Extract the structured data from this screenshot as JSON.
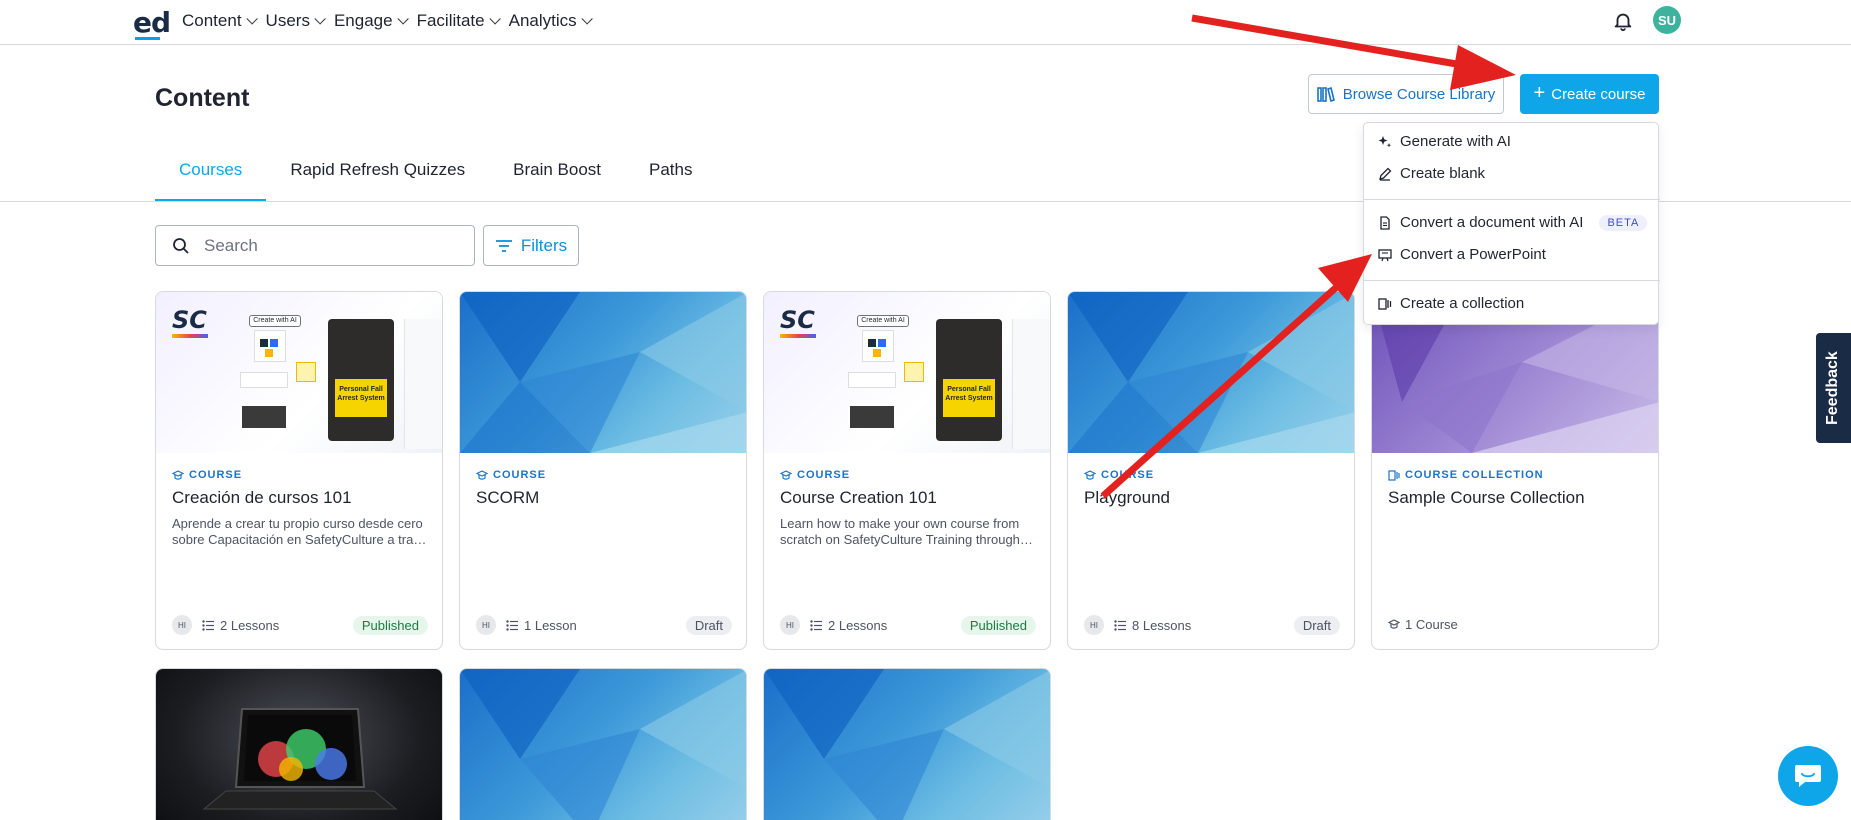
{
  "nav": {
    "logo": "ed",
    "items": [
      "Content",
      "Users",
      "Engage",
      "Facilitate",
      "Analytics"
    ],
    "avatar_initials": "SU"
  },
  "header": {
    "title": "Content",
    "browse_label": "Browse Course Library",
    "create_label": "Create course"
  },
  "tabs": [
    "Courses",
    "Rapid Refresh Quizzes",
    "Brain Boost",
    "Paths"
  ],
  "search": {
    "placeholder": "Search"
  },
  "filters_label": "Filters",
  "menu": {
    "items": [
      "Generate with AI",
      "Create blank",
      "Convert a document with AI",
      "Convert a PowerPoint",
      "Create a collection"
    ],
    "beta_label": "BETA"
  },
  "cards": [
    {
      "type": "COURSE",
      "title": "Creación de cursos 101",
      "desc1": "Aprende a crear tu propio curso desde cero",
      "desc2": "sobre Capacitación en SafetyCulture a través de",
      "initials": "HI",
      "lessons": "2 Lessons",
      "status": "Published"
    },
    {
      "type": "COURSE",
      "title": "SCORM",
      "desc1": "",
      "desc2": "",
      "initials": "HI",
      "lessons": "1 Lesson",
      "status": "Draft"
    },
    {
      "type": "COURSE",
      "title": "Course Creation 101",
      "desc1": "Learn how to make your own course from",
      "desc2": "scratch on SafetyCulture Training through the",
      "initials": "HI",
      "lessons": "2 Lessons",
      "status": "Published"
    },
    {
      "type": "COURSE",
      "title": "Playground",
      "desc1": "",
      "desc2": "",
      "initials": "HI",
      "lessons": "8 Lessons",
      "status": "Draft"
    },
    {
      "type": "COURSE COLLECTION",
      "title": "Sample Course Collection",
      "desc1": "",
      "desc2": "",
      "initials": "",
      "lessons": "1 Course",
      "status": ""
    }
  ],
  "thumb_text": {
    "sc_logo": "SC",
    "create_with_ai": "Create with AI",
    "personal_fall": "Personal Fall Arrest System"
  },
  "feedback_label": "Feedback",
  "colors": {
    "accent": "#0ea5e9",
    "arrow": "#e3211f",
    "brand": "#1a2b45"
  }
}
